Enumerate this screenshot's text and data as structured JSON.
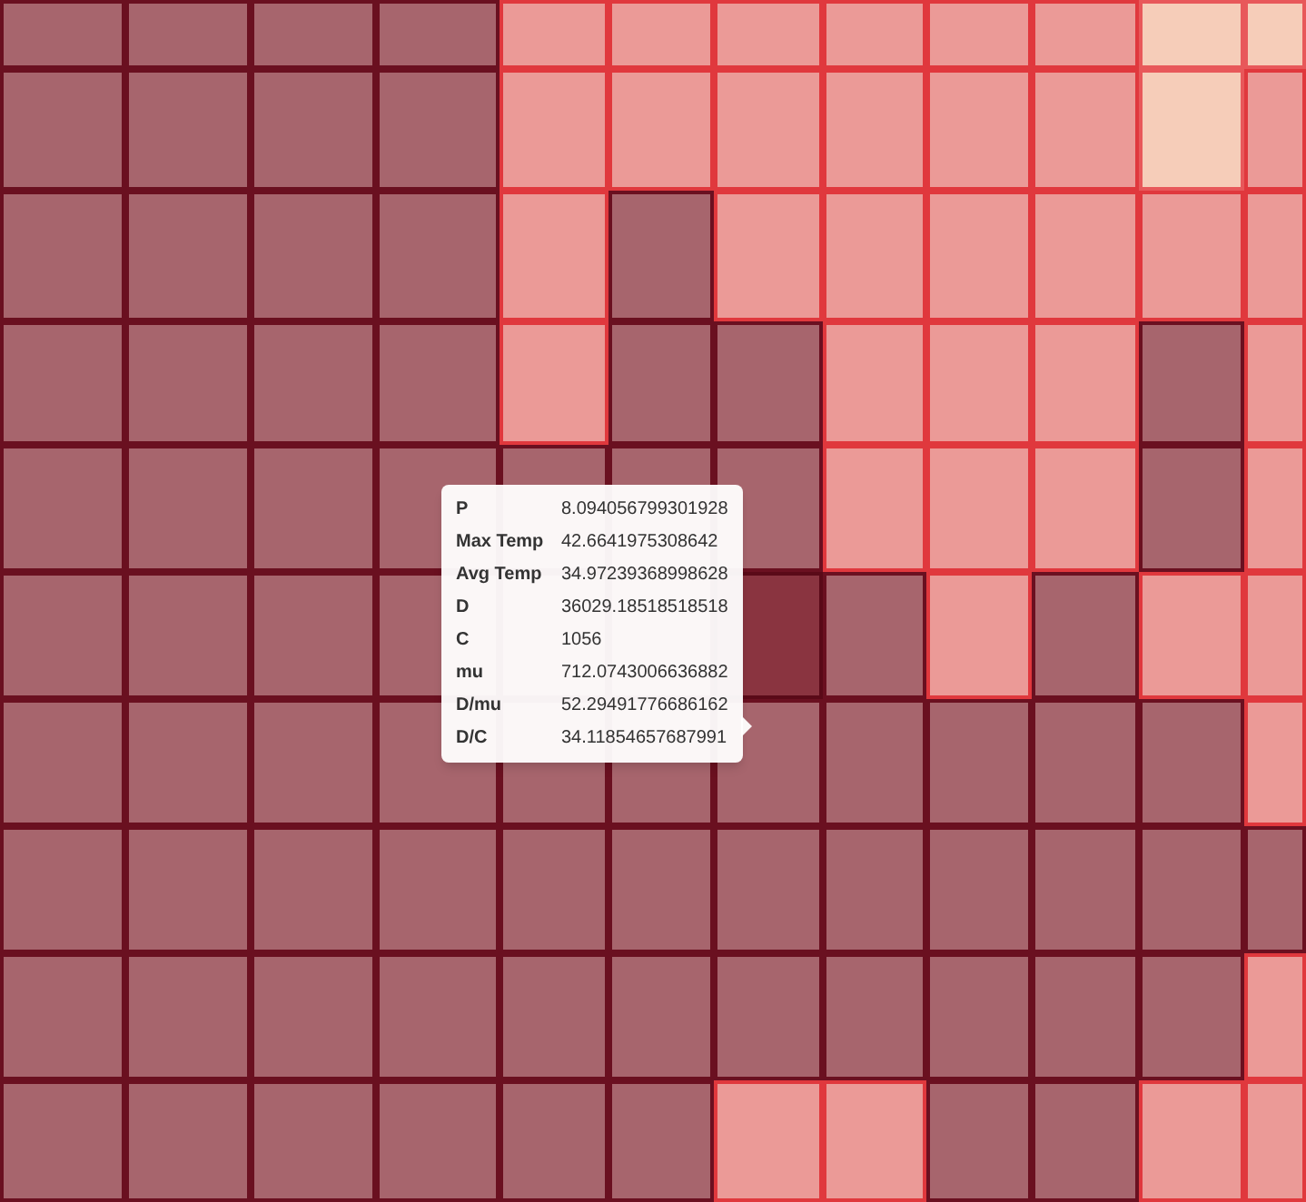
{
  "tooltip": {
    "rows": [
      {
        "label": "P",
        "value": "8.094056799301928"
      },
      {
        "label": "Max Temp",
        "value": "42.6641975308642"
      },
      {
        "label": "Avg Temp",
        "value": "34.97239368998628"
      },
      {
        "label": "D",
        "value": "36029.18518518518"
      },
      {
        "label": "C",
        "value": "1056"
      },
      {
        "label": "mu",
        "value": "712.0743006636882"
      },
      {
        "label": "D/mu",
        "value": "52.29491776686162"
      },
      {
        "label": "D/C",
        "value": "34.11854657687991"
      }
    ]
  }
}
